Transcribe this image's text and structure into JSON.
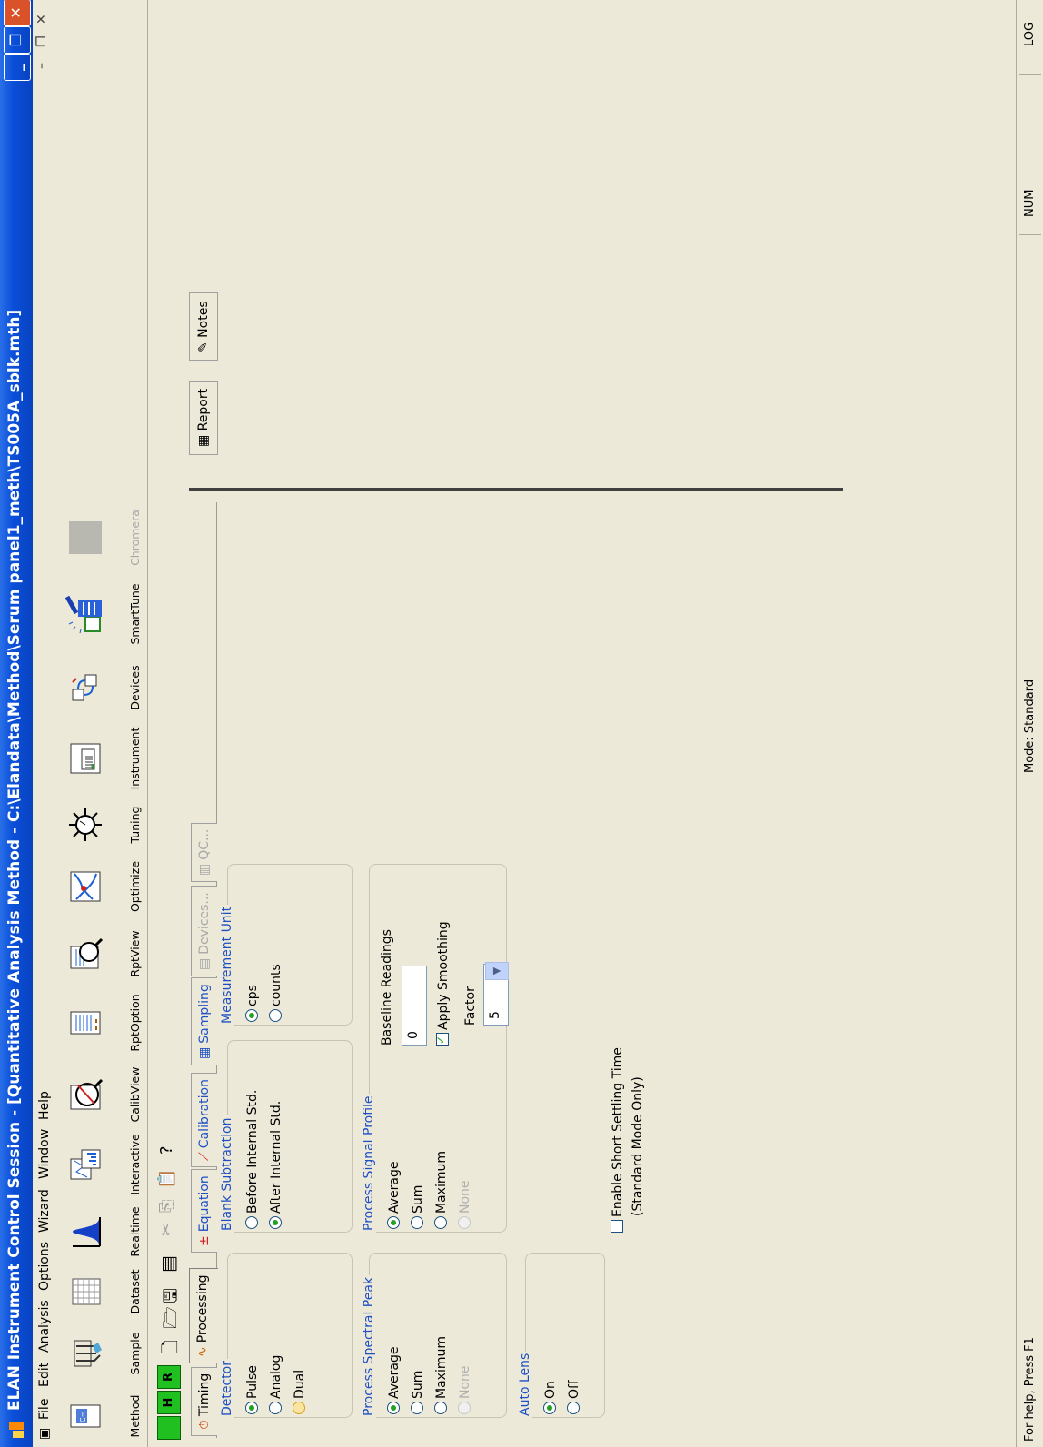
{
  "window": {
    "title": "ELAN Instrument Control Session - [Quantitative Analysis Method - C:\\Elandata\\Method\\Serum panel1_meth\\TS005A_sblk.mth]",
    "controls": [
      "minimize",
      "restore",
      "close"
    ]
  },
  "menu": [
    "File",
    "Edit",
    "Analysis",
    "Options",
    "Wizard",
    "Window",
    "Help"
  ],
  "toolbar": [
    {
      "label": "Method",
      "icon": "method-icon"
    },
    {
      "label": "Sample",
      "icon": "sample-icon"
    },
    {
      "label": "Dataset",
      "icon": "dataset-icon"
    },
    {
      "label": "Realtime",
      "icon": "realtime-icon"
    },
    {
      "label": "Interactive",
      "icon": "interactive-icon"
    },
    {
      "label": "CalibView",
      "icon": "calibview-icon"
    },
    {
      "label": "RptOption",
      "icon": "rptoption-icon"
    },
    {
      "label": "RptView",
      "icon": "rptview-icon"
    },
    {
      "label": "Optimize",
      "icon": "optimize-icon"
    },
    {
      "label": "Tuning",
      "icon": "tuning-icon"
    },
    {
      "label": "Instrument",
      "icon": "instrument-icon"
    },
    {
      "label": "Devices",
      "icon": "devices-icon"
    },
    {
      "label": "SmartTune",
      "icon": "smarttune-icon"
    },
    {
      "label": "Chromera",
      "icon": "chromera-icon",
      "disabled": true
    }
  ],
  "method_tabs": [
    "Timing",
    "Processing",
    "Equation",
    "Calibration",
    "Sampling",
    "Devices...",
    "QC..."
  ],
  "active_tab": "Processing",
  "processing": {
    "detector": {
      "title": "Detector",
      "options": [
        "Pulse",
        "Analog",
        "Dual"
      ],
      "selected": "Pulse"
    },
    "blank_subtraction": {
      "title": "Blank Subtraction",
      "options": [
        "Before Internal Std.",
        "After Internal Std."
      ],
      "selected": "After Internal Std."
    },
    "measurement_unit": {
      "title": "Measurement Unit",
      "options": [
        "cps",
        "counts"
      ],
      "selected": "cps"
    },
    "spectral_peak": {
      "title": "Process Spectral Peak",
      "options": [
        "Average",
        "Sum",
        "Maximum",
        "None"
      ],
      "selected": "Average"
    },
    "signal_profile": {
      "title": "Process Signal Profile",
      "options": [
        "Average",
        "Sum",
        "Maximum",
        "None"
      ],
      "selected": "Average"
    },
    "auto_lens": {
      "title": "Auto Lens",
      "options": [
        "On",
        "Off"
      ],
      "selected": "On"
    },
    "baseline_readings": {
      "label": "Baseline Readings",
      "value": "0"
    },
    "apply_smoothing": {
      "label": "Apply Smoothing",
      "checked": true
    },
    "factor": {
      "label": "Factor",
      "value": "5"
    },
    "short_settling": {
      "label": "Enable Short Settling Time",
      "sublabel": "(Standard Mode Only)",
      "checked": false
    }
  },
  "report_tabs": [
    "Report",
    "Notes"
  ],
  "status": {
    "help": "For help, Press F1",
    "mode": "Mode: Standard",
    "num": "NUM",
    "log": "LOG"
  }
}
